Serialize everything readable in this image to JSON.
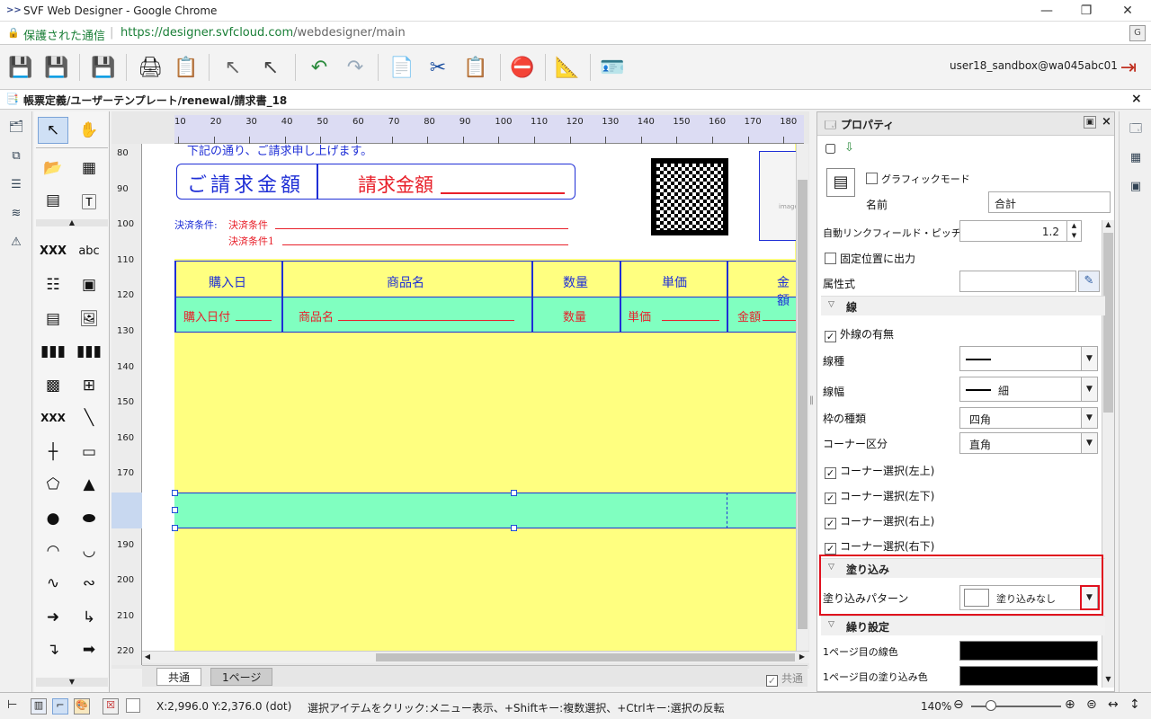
{
  "window": {
    "title": "SVF Web Designer - Google Chrome",
    "min": "—",
    "restore": "❐",
    "close": "✕"
  },
  "address": {
    "secure_label": "保護された通信",
    "url_host": "https://designer.svfcloud.com",
    "url_path": "/webdesigner/main"
  },
  "toolbar": {
    "user": "user18_sandbox@wa045abc01"
  },
  "document": {
    "path": "帳票定義/ユーザーテンプレート/renewal/請求書_18"
  },
  "ruler": {
    "h": [
      "10",
      "20",
      "30",
      "40",
      "50",
      "60",
      "70",
      "80",
      "90",
      "100",
      "110",
      "120",
      "130",
      "140",
      "150",
      "160",
      "170",
      "180"
    ],
    "v": [
      "80",
      "90",
      "100",
      "110",
      "120",
      "130",
      "140",
      "150",
      "160",
      "170",
      "180",
      "190",
      "200",
      "210",
      "220"
    ]
  },
  "form": {
    "intro": "下記の通り、ご請求申し上げます。",
    "title_label": "ご請求金額",
    "title_value": "請求金額",
    "pay_label": "決済条件:",
    "pay_value1": "決済条件",
    "pay_value2": "決済条件1",
    "qr_label": "QR",
    "img_label": "image",
    "headers": [
      "購入日",
      "商品名",
      "数量",
      "単価",
      "金額"
    ],
    "fields": [
      "購入日付",
      "商品名",
      "数量",
      "単価",
      "金額"
    ]
  },
  "tabs": {
    "common": "共通",
    "page1": "1ページ",
    "common_check": "共通"
  },
  "properties": {
    "title": "プロパティ",
    "graphic_mode": "グラフィックモード",
    "name_label": "名前",
    "name_value": "合計",
    "autolink_label": "自動リンクフィールド・ピッチ(倍)",
    "autolink_value": "1.2",
    "fixed_pos": "固定位置に出力",
    "attr_label": "属性式",
    "line_section": "線",
    "outer_line": "外線の有無",
    "line_type": "線種",
    "line_width": "線幅",
    "line_width_value": "細",
    "frame_type": "枠の種類",
    "frame_type_value": "四角",
    "corner_type": "コーナー区分",
    "corner_type_value": "直角",
    "corners": [
      "コーナー選択(左上)",
      "コーナー選択(左下)",
      "コーナー選択(右上)",
      "コーナー選択(右下)"
    ],
    "fill_section": "塗り込み",
    "fill_pattern": "塗り込みパターン",
    "fill_pattern_value": "塗り込みなし",
    "repeat_section": "繰り設定",
    "page1_line_color": "1ページ目の線色",
    "page1_fill_color": "1ページ目の塗り込み色"
  },
  "status": {
    "coords": "X:2,996.0 Y:2,376.0 (dot)",
    "message": "選択アイテムをクリック:メニュー表示、+Shiftキー:複数選択、+Ctrlキー:選択の反転",
    "zoom": "140%"
  },
  "colors": {
    "yellow": "#ffff80",
    "green": "#80ffc0",
    "blue": "#1f2fd6",
    "red": "#e8202a",
    "highlight": "#e0101e"
  }
}
